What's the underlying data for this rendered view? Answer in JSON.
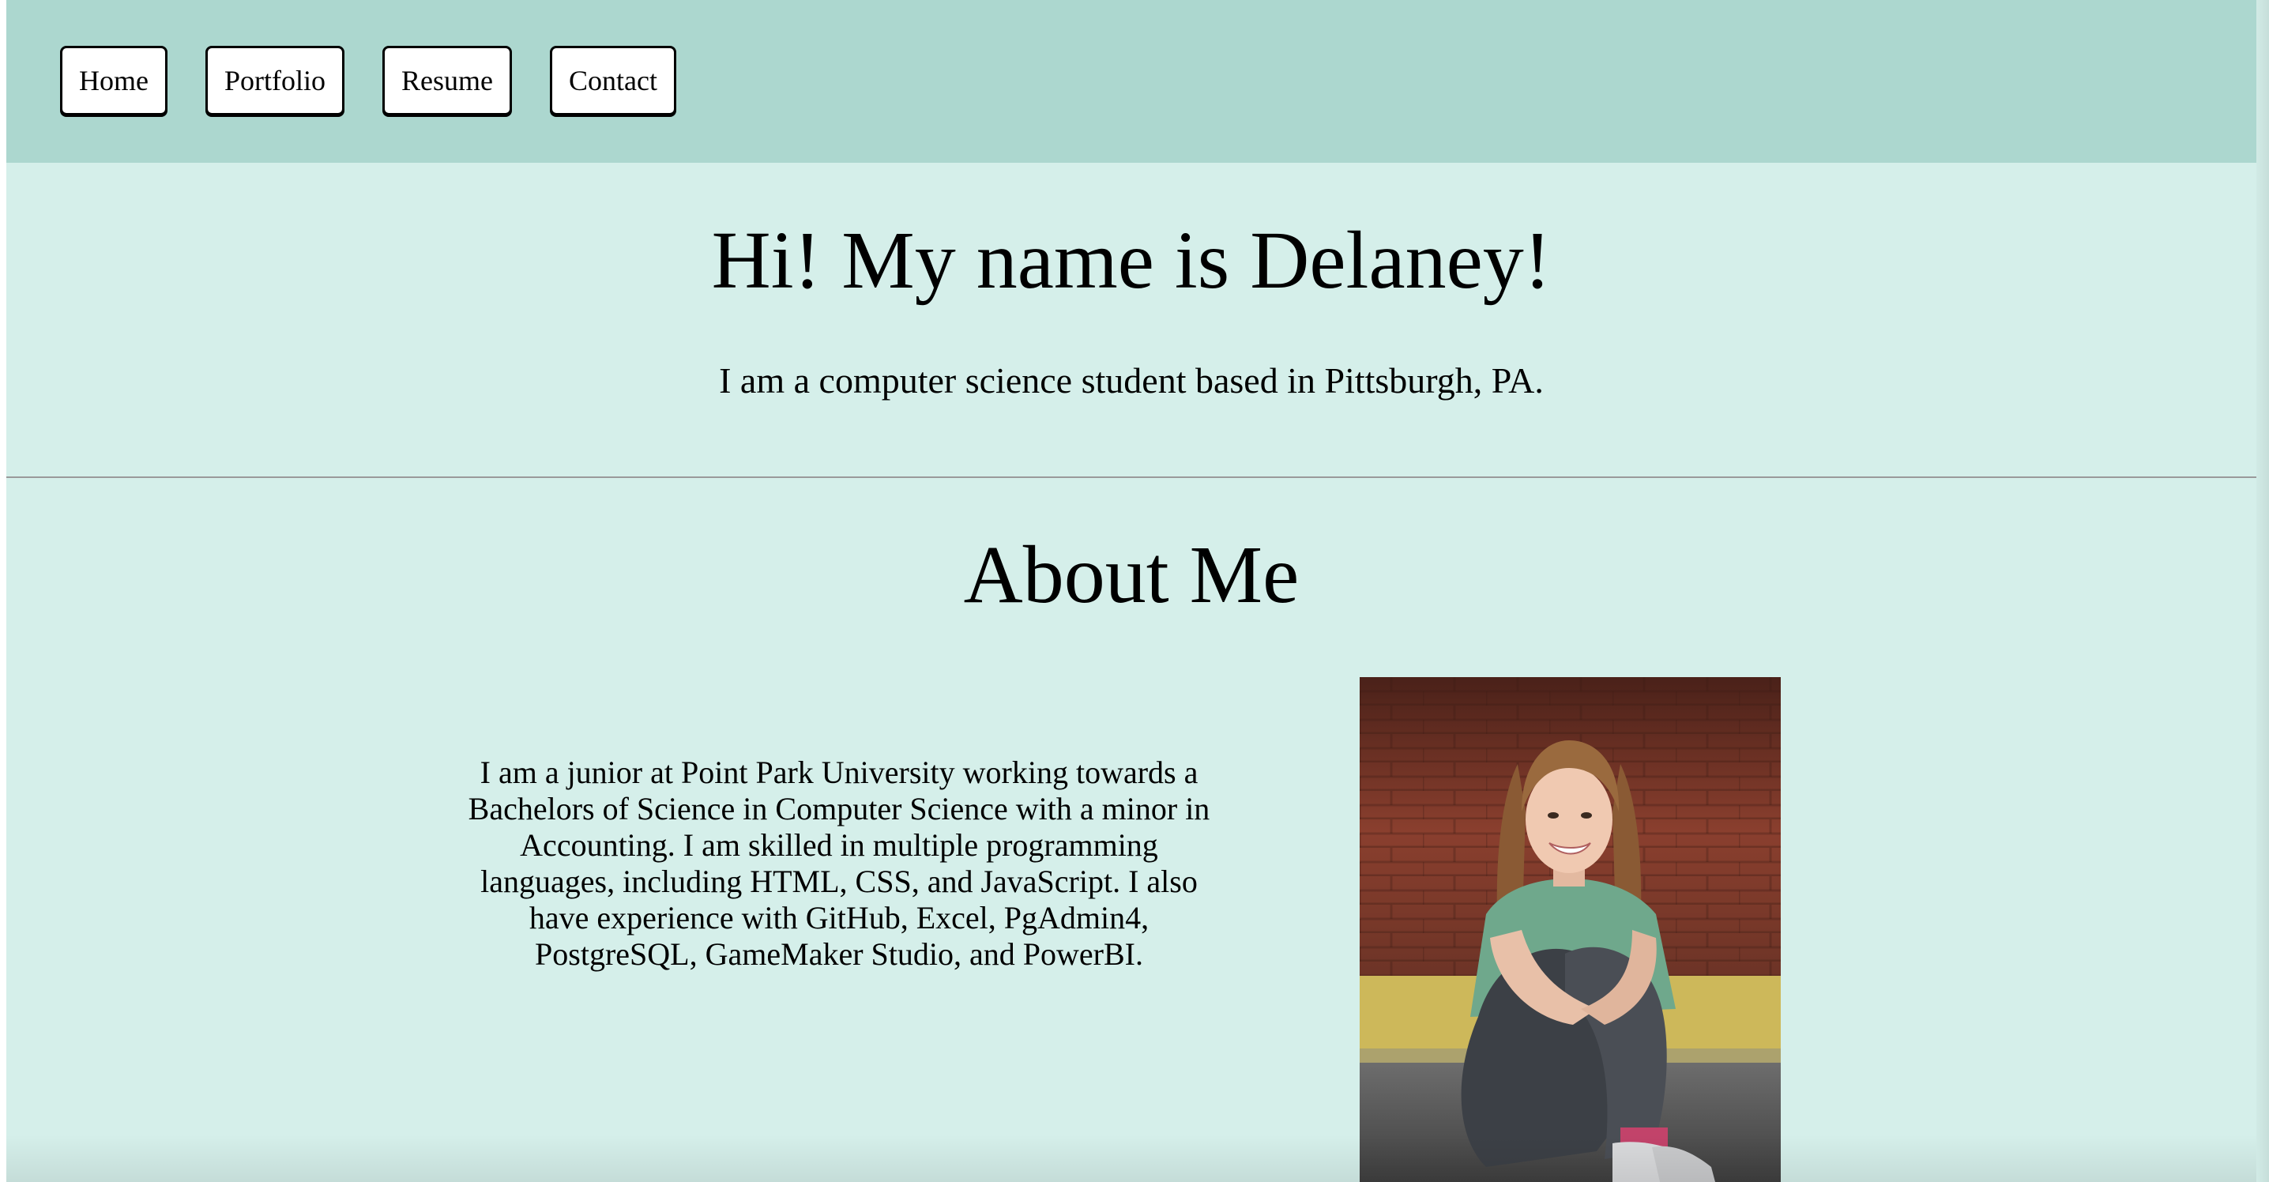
{
  "nav": {
    "home": "Home",
    "portfolio": "Portfolio",
    "resume": "Resume",
    "contact": "Contact"
  },
  "hero": {
    "title": "Hi! My name is Delaney!",
    "subtitle": "I am a computer science student based in Pittsburgh, PA."
  },
  "about": {
    "title": "About Me",
    "text": "I am a junior at Point Park University working towards a Bachelors of Science in Computer Science with a minor in Accounting. I am skilled in multiple programming languages, including HTML, CSS, and JavaScript. I also have experience with GitHub, Excel, PgAdmin4, PostgreSQL, GameMaker Studio, and PowerBI.",
    "photo_icon": "portrait-photo"
  },
  "colors": {
    "page_background": "#d5efea",
    "navbar_background": "#acd7cf",
    "button_background": "#ffffff",
    "divider": "#9a9a9a"
  }
}
